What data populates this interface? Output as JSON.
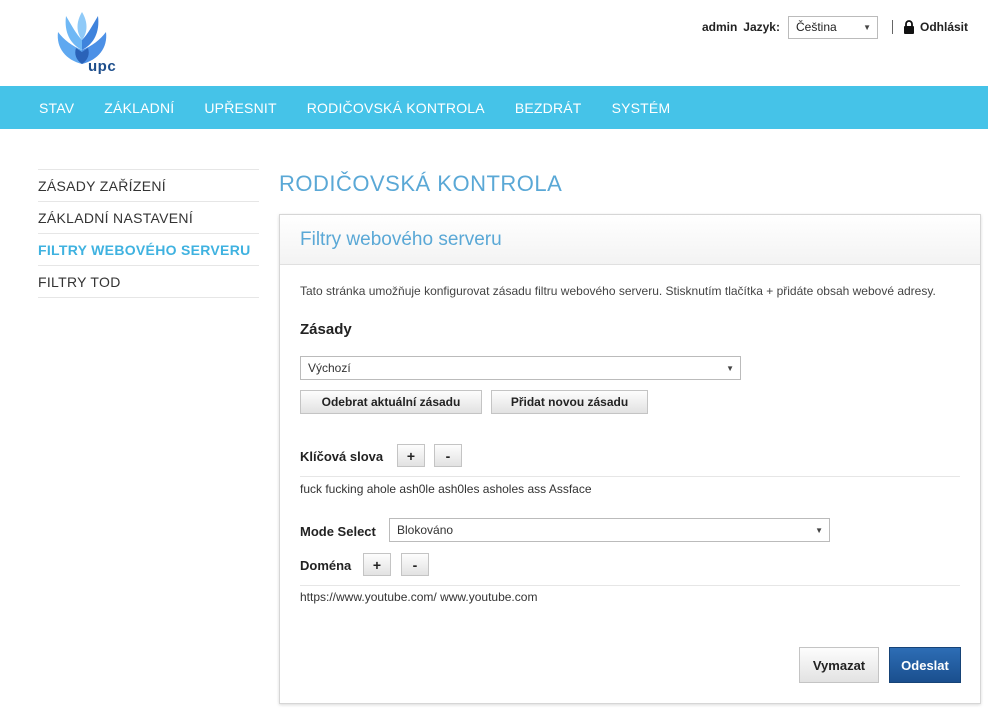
{
  "header": {
    "logo_text": "upc",
    "user": "admin",
    "language_label": "Jazyk:",
    "language_value": "Čeština",
    "logout_label": "Odhlásit"
  },
  "nav": {
    "items": [
      {
        "label": "STAV"
      },
      {
        "label": "ZÁKLADNÍ"
      },
      {
        "label": "UPŘESNIT"
      },
      {
        "label": "RODIČOVSKÁ KONTROLA"
      },
      {
        "label": "BEZDRÁT"
      },
      {
        "label": "SYSTÉM"
      }
    ]
  },
  "sidebar": {
    "items": [
      {
        "label": "ZÁSADY ZAŘÍZENÍ"
      },
      {
        "label": "ZÁKLADNÍ NASTAVENÍ"
      },
      {
        "label": "FILTRY WEBOVÉHO SERVERU"
      },
      {
        "label": "FILTRY TOD"
      }
    ]
  },
  "main": {
    "page_title": "RODIČOVSKÁ KONTROLA",
    "panel_title": "Filtry webového serveru",
    "description": "Tato stránka umožňuje konfigurovat zásadu filtru webového serveru. Stisknutím tlačítka + přidáte obsah webové adresy.",
    "policies_heading": "Zásady",
    "policy_select_value": "Výchozí",
    "remove_policy_label": "Odebrat aktuální zásadu",
    "add_policy_label": "Přidat novou zásadu",
    "keywords_label": "Klíčová slova",
    "plus_label": "+",
    "minus_label": "-",
    "keywords_value": "fuck fucking ahole ash0le ash0les asholes ass Assface",
    "mode_label": "Mode Select",
    "mode_value": "Blokováno",
    "domain_label": "Doména",
    "domain_value": "https://www.youtube.com/ www.youtube.com",
    "clear_label": "Vymazat",
    "submit_label": "Odeslat"
  },
  "colors": {
    "nav_bg": "#45c3e8",
    "title_blue": "#5aa8d6",
    "active_side": "#3fb2e0",
    "submit_blue": "#1a4f8e"
  }
}
